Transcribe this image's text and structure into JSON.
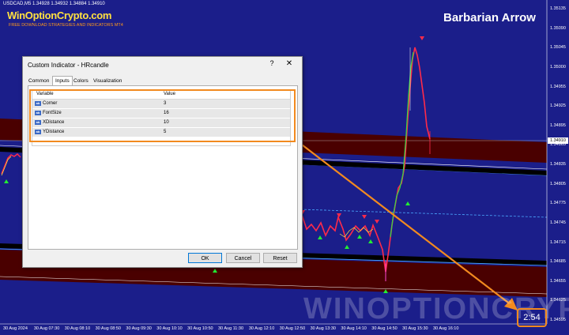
{
  "chart": {
    "symbol": "USDCAD,M5  1.34928 1.34932 1.34884 1.34910",
    "brand": "WinOptionCrypto.com",
    "brand_sub": "FREE DOWNLOAD STRATEGIES AND INDICATORS MT4",
    "indicator_title": "Barbarian Arrow",
    "watermark": "WINOPTIONCRYPTO.COM",
    "counter": "2:54",
    "current_price": "1.34910",
    "price_labels": [
      "1.35135",
      "1.35090",
      "1.35045",
      "1.35000",
      "1.34955",
      "1.34925",
      "1.34895",
      "1.34865",
      "1.34835",
      "1.34805",
      "1.34775",
      "1.34745",
      "1.34715",
      "1.34685",
      "1.34655",
      "1.34625",
      "1.34595"
    ],
    "time_labels": [
      "30 Aug 2024",
      "30 Aug 07:30",
      "30 Aug 08:10",
      "30 Aug 08:50",
      "30 Aug 09:30",
      "30 Aug 10:10",
      "30 Aug 10:50",
      "30 Aug 11:30",
      "30 Aug 12:10",
      "30 Aug 12:50",
      "30 Aug 13:30",
      "30 Aug 14:10",
      "30 Aug 14:50",
      "30 Aug 15:30",
      "30 Aug 16:10"
    ],
    "colors": {
      "background": "#1b1e8a",
      "band": "#4a0000",
      "up_arrow": "#22ee33",
      "down_arrow": "#ff2a4a",
      "annotation": "#f28a1f"
    }
  },
  "dialog": {
    "title": "Custom Indicator - HRcandle",
    "help": "?",
    "close": "✕",
    "tabs": [
      {
        "label": "Common",
        "active": false
      },
      {
        "label": "Inputs",
        "active": true
      },
      {
        "label": "Colors",
        "active": false
      },
      {
        "label": "Visualization",
        "active": false
      }
    ],
    "columns": {
      "variable": "Variable",
      "value": "Value"
    },
    "row_icon": "ab",
    "rows": [
      {
        "variable": "Corner",
        "value": "3"
      },
      {
        "variable": "FontSize",
        "value": "16"
      },
      {
        "variable": "XDistance",
        "value": "10"
      },
      {
        "variable": "YDistance",
        "value": "5"
      }
    ],
    "buttons": {
      "ok": "OK",
      "cancel": "Cancel",
      "reset": "Reset"
    }
  }
}
